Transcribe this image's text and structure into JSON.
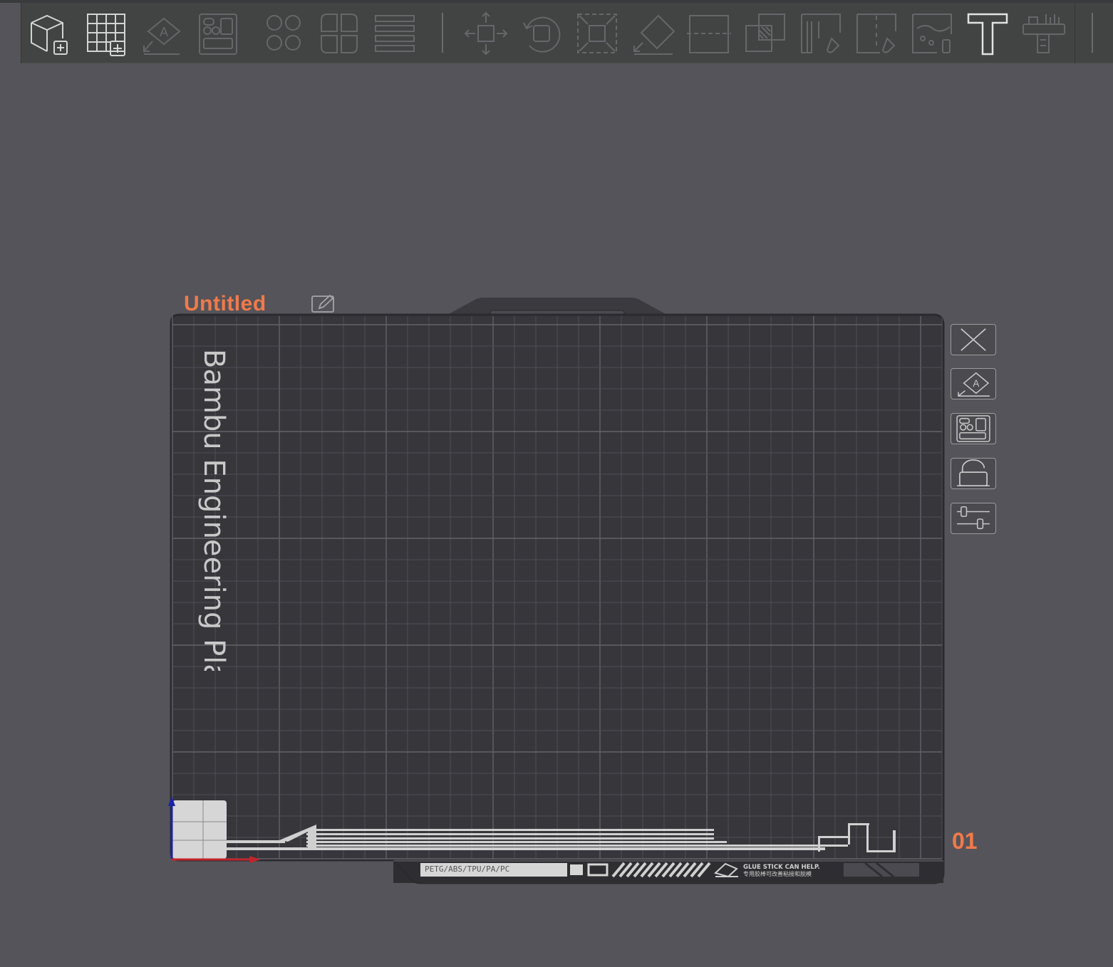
{
  "toolbar": {
    "buttons": [
      {
        "id": "add-object",
        "icon": "cube-plus-icon",
        "enabled": true
      },
      {
        "id": "add-plate",
        "icon": "grid-plus-icon",
        "enabled": true
      },
      {
        "id": "auto-orient",
        "icon": "auto-orient-icon",
        "enabled": false
      },
      {
        "id": "arrange",
        "icon": "arrange-icon",
        "enabled": false
      },
      {
        "id": "split-objects",
        "icon": "split-objects-icon",
        "enabled": false
      },
      {
        "id": "split-parts",
        "icon": "split-parts-icon",
        "enabled": false
      },
      {
        "id": "layers",
        "icon": "layers-icon",
        "enabled": false
      },
      {
        "id": "move",
        "icon": "move-icon",
        "enabled": false
      },
      {
        "id": "rotate",
        "icon": "rotate-icon",
        "enabled": false
      },
      {
        "id": "scale",
        "icon": "scale-icon",
        "enabled": false
      },
      {
        "id": "lay-on-face",
        "icon": "lay-on-face-icon",
        "enabled": false
      },
      {
        "id": "cut",
        "icon": "cut-icon",
        "enabled": false
      },
      {
        "id": "boolean",
        "icon": "boolean-icon",
        "enabled": false
      },
      {
        "id": "support-paint",
        "icon": "support-paint-icon",
        "enabled": false
      },
      {
        "id": "seam-paint",
        "icon": "seam-paint-icon",
        "enabled": false
      },
      {
        "id": "color-paint",
        "icon": "color-paint-icon",
        "enabled": false
      },
      {
        "id": "text",
        "icon": "text-tool-icon",
        "enabled": true
      },
      {
        "id": "measure",
        "icon": "measure-icon",
        "enabled": false
      }
    ]
  },
  "plate": {
    "title": "Untitled",
    "edit_icon": "pencil-edit-icon",
    "bed_label": "Bambu Engineering Plate",
    "number": "01",
    "material_text": "PETG/ABS/TPU/PA/PC",
    "glue_text_en": "GLUE STICK CAN HELP.",
    "glue_text_cn": "专用胶棒可改善粘接和脱模"
  },
  "side_buttons": [
    {
      "id": "delete-plate",
      "icon": "close-x-icon"
    },
    {
      "id": "orient-plate",
      "icon": "auto-orient-icon"
    },
    {
      "id": "arrange-plate",
      "icon": "arrange-icon"
    },
    {
      "id": "lock-plate",
      "icon": "unlock-icon"
    },
    {
      "id": "plate-settings",
      "icon": "sliders-icon"
    }
  ],
  "colors": {
    "background": "#55545a",
    "toolbar": "#414442",
    "accent": "#f27a4a",
    "plate": "#36363b",
    "grid": "#4e4f55",
    "grid_major": "#626368",
    "axis_x": "#c0242c",
    "axis_y": "#1a23a8"
  }
}
